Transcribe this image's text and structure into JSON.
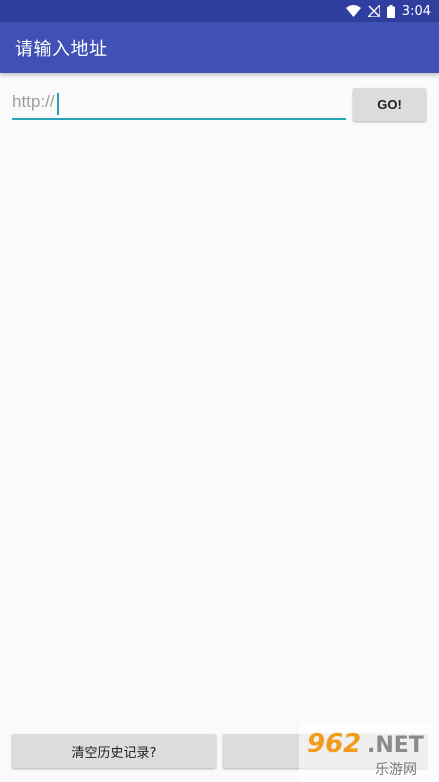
{
  "status_bar": {
    "time": "3:04",
    "icons": [
      "wifi-icon",
      "no-signal-icon",
      "battery-icon"
    ]
  },
  "app_bar": {
    "title": "请输入地址",
    "color": "#3f51b5",
    "status_color": "#303f9f"
  },
  "url": {
    "placeholder": "http://",
    "value": "",
    "accent": "#26a5b8"
  },
  "go_button": {
    "label": "GO!"
  },
  "bottom": {
    "clear_history_label": "清空历史记录?",
    "second_label": ""
  },
  "watermark": {
    "text": "962.NET 乐游网"
  }
}
